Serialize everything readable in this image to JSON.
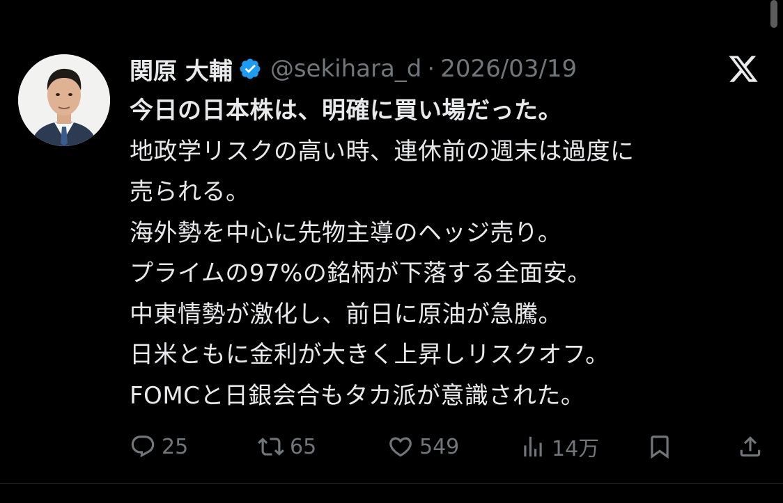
{
  "author": {
    "name": "関原 大輔",
    "handle": "@sekihara_d",
    "separator": "·",
    "date": "2026/03/19",
    "verified": true,
    "verified_color": "#1d9bf0"
  },
  "tweet": {
    "lines": [
      "今日の日本株は、明確に買い場だった。",
      "地政学リスクの高い時、連休前の週末は過度に",
      "売られる。",
      "海外勢を中心に先物主導のヘッジ売り。",
      "プライムの97%の銘柄が下落する全面安。",
      "中東情勢が激化し、前日に原油が急騰。",
      "日米ともに金利が大きく上昇しリスクオフ。",
      "FOMCと日銀会合もタカ派が意識された。"
    ]
  },
  "actions": {
    "reply": {
      "icon": "reply-icon",
      "count": "25"
    },
    "repost": {
      "icon": "repost-icon",
      "count": "65"
    },
    "like": {
      "icon": "heart-icon",
      "count": "549"
    },
    "views": {
      "icon": "views-icon",
      "count": "14万"
    },
    "bookmark": {
      "icon": "bookmark-icon"
    },
    "share": {
      "icon": "share-icon"
    }
  },
  "colors": {
    "background": "#000000",
    "text": "#e7e9ea",
    "muted": "#71767b",
    "accent": "#1d9bf0"
  }
}
